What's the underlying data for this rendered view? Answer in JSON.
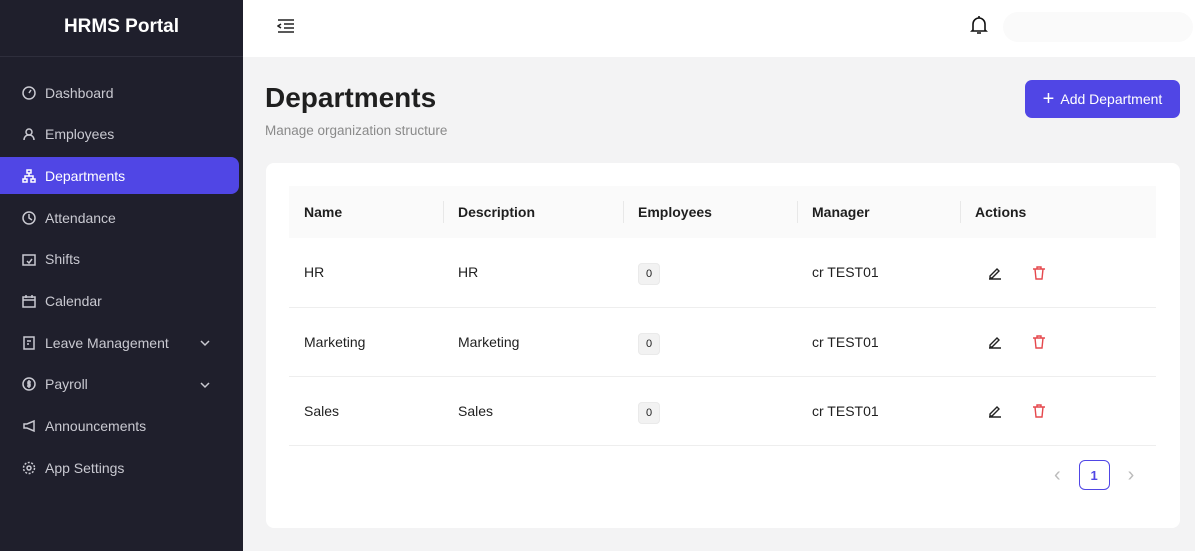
{
  "app": {
    "title": "HRMS Portal"
  },
  "sidebar": {
    "items": [
      {
        "label": "Dashboard"
      },
      {
        "label": "Employees"
      },
      {
        "label": "Departments"
      },
      {
        "label": "Attendance"
      },
      {
        "label": "Shifts"
      },
      {
        "label": "Calendar"
      },
      {
        "label": "Leave Management"
      },
      {
        "label": "Payroll"
      },
      {
        "label": "Announcements"
      },
      {
        "label": "App Settings"
      }
    ]
  },
  "page": {
    "title": "Departments",
    "subtitle": "Manage organization structure",
    "add_label": "Add Department"
  },
  "table": {
    "headers": [
      "Name",
      "Description",
      "Employees",
      "Manager",
      "Actions"
    ],
    "rows": [
      {
        "name": "HR",
        "description": "HR",
        "employees": "0",
        "manager": "cr TEST01"
      },
      {
        "name": "Marketing",
        "description": "Marketing",
        "employees": "0",
        "manager": "cr TEST01"
      },
      {
        "name": "Sales",
        "description": "Sales",
        "employees": "0",
        "manager": "cr TEST01"
      }
    ]
  },
  "pagination": {
    "current": "1",
    "prev": "‹",
    "next": "›"
  },
  "colors": {
    "accent": "#5046e5",
    "sidebar": "#1f1f2c",
    "danger": "#e5484d"
  }
}
